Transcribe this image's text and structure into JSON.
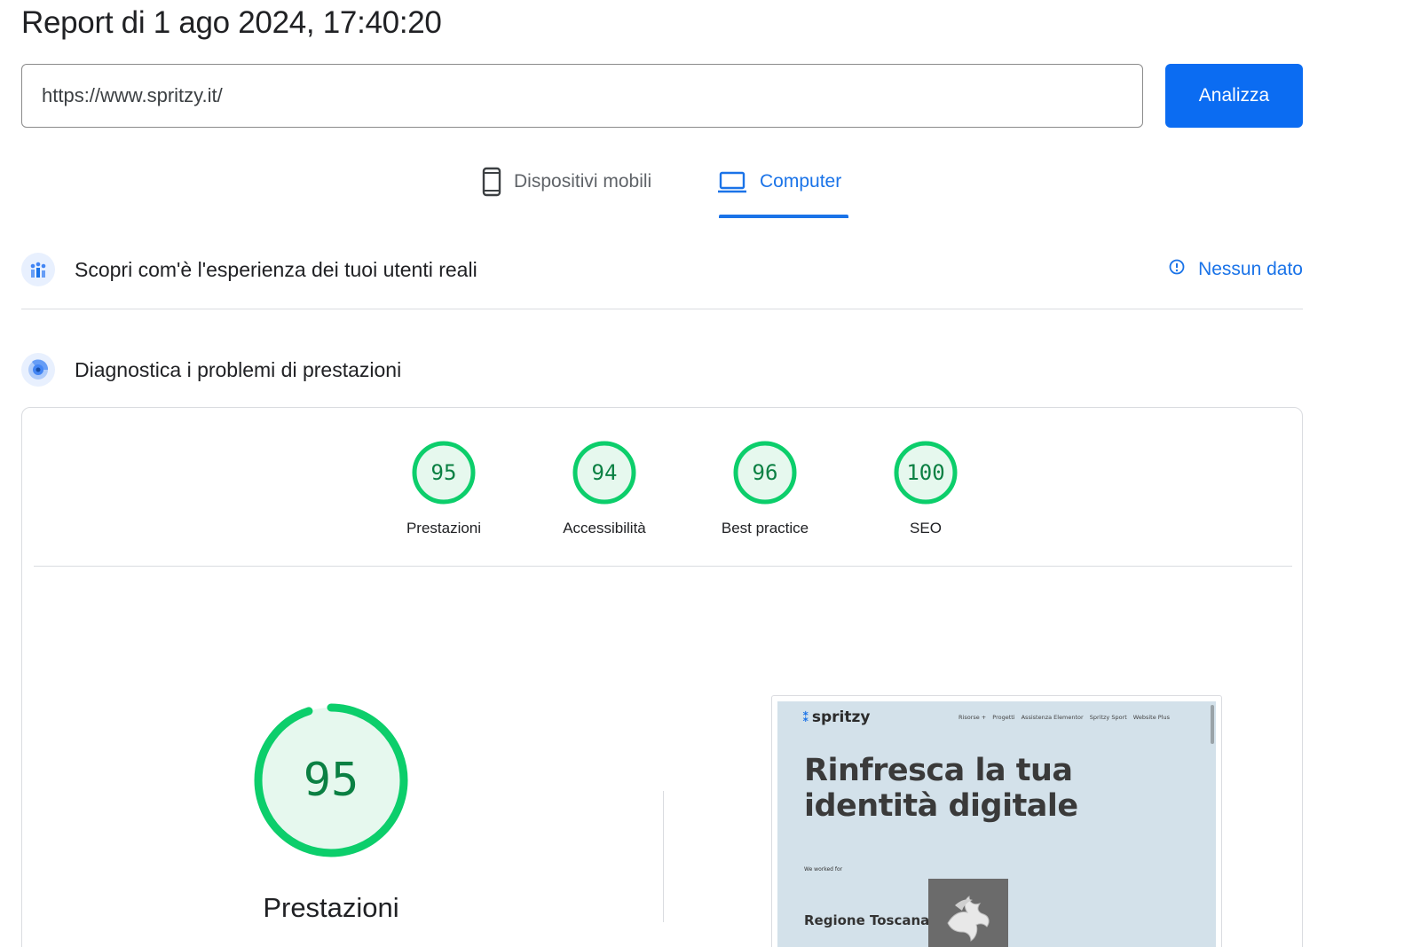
{
  "report": {
    "title": "Report di 1 ago 2024, 17:40:20"
  },
  "search": {
    "url_value": "https://www.spritzy.it/",
    "analyze_label": "Analizza"
  },
  "tabs": [
    {
      "label": "Dispositivi mobili",
      "icon": "smartphone-icon",
      "selected": false
    },
    {
      "label": "Computer",
      "icon": "laptop-icon",
      "selected": true
    }
  ],
  "field_data": {
    "title": "Scopri com'è l'esperienza dei tuoi utenti reali",
    "status": "Nessun dato",
    "icon": "users-chart-icon",
    "status_icon": "info-icon"
  },
  "lab_data": {
    "title": "Diagnostica i problemi di prestazioni",
    "icon": "radar-icon"
  },
  "scores": [
    {
      "label": "Prestazioni",
      "value": "95"
    },
    {
      "label": "Accessibilità",
      "value": "94"
    },
    {
      "label": "Best practice",
      "value": "96"
    },
    {
      "label": "SEO",
      "value": "100"
    }
  ],
  "main_gauge": {
    "label": "Prestazioni",
    "value": "95"
  },
  "colors": {
    "pass_green": "#0cce6b",
    "pass_fill": "#e6f8ee",
    "pass_text": "#0b8043",
    "accent_blue": "#1a73e8",
    "button_blue": "#0b6cf2"
  },
  "preview": {
    "logo": "spritzy",
    "nav": [
      "Risorse +",
      "Progetti",
      "Assistenza Elementor",
      "Spritzy Sport",
      "Website Plus"
    ],
    "headline_line1": "Rinfresca la tua",
    "headline_line2": "identità digitale",
    "worked_for": "We worked for",
    "client": "Regione Toscana"
  }
}
